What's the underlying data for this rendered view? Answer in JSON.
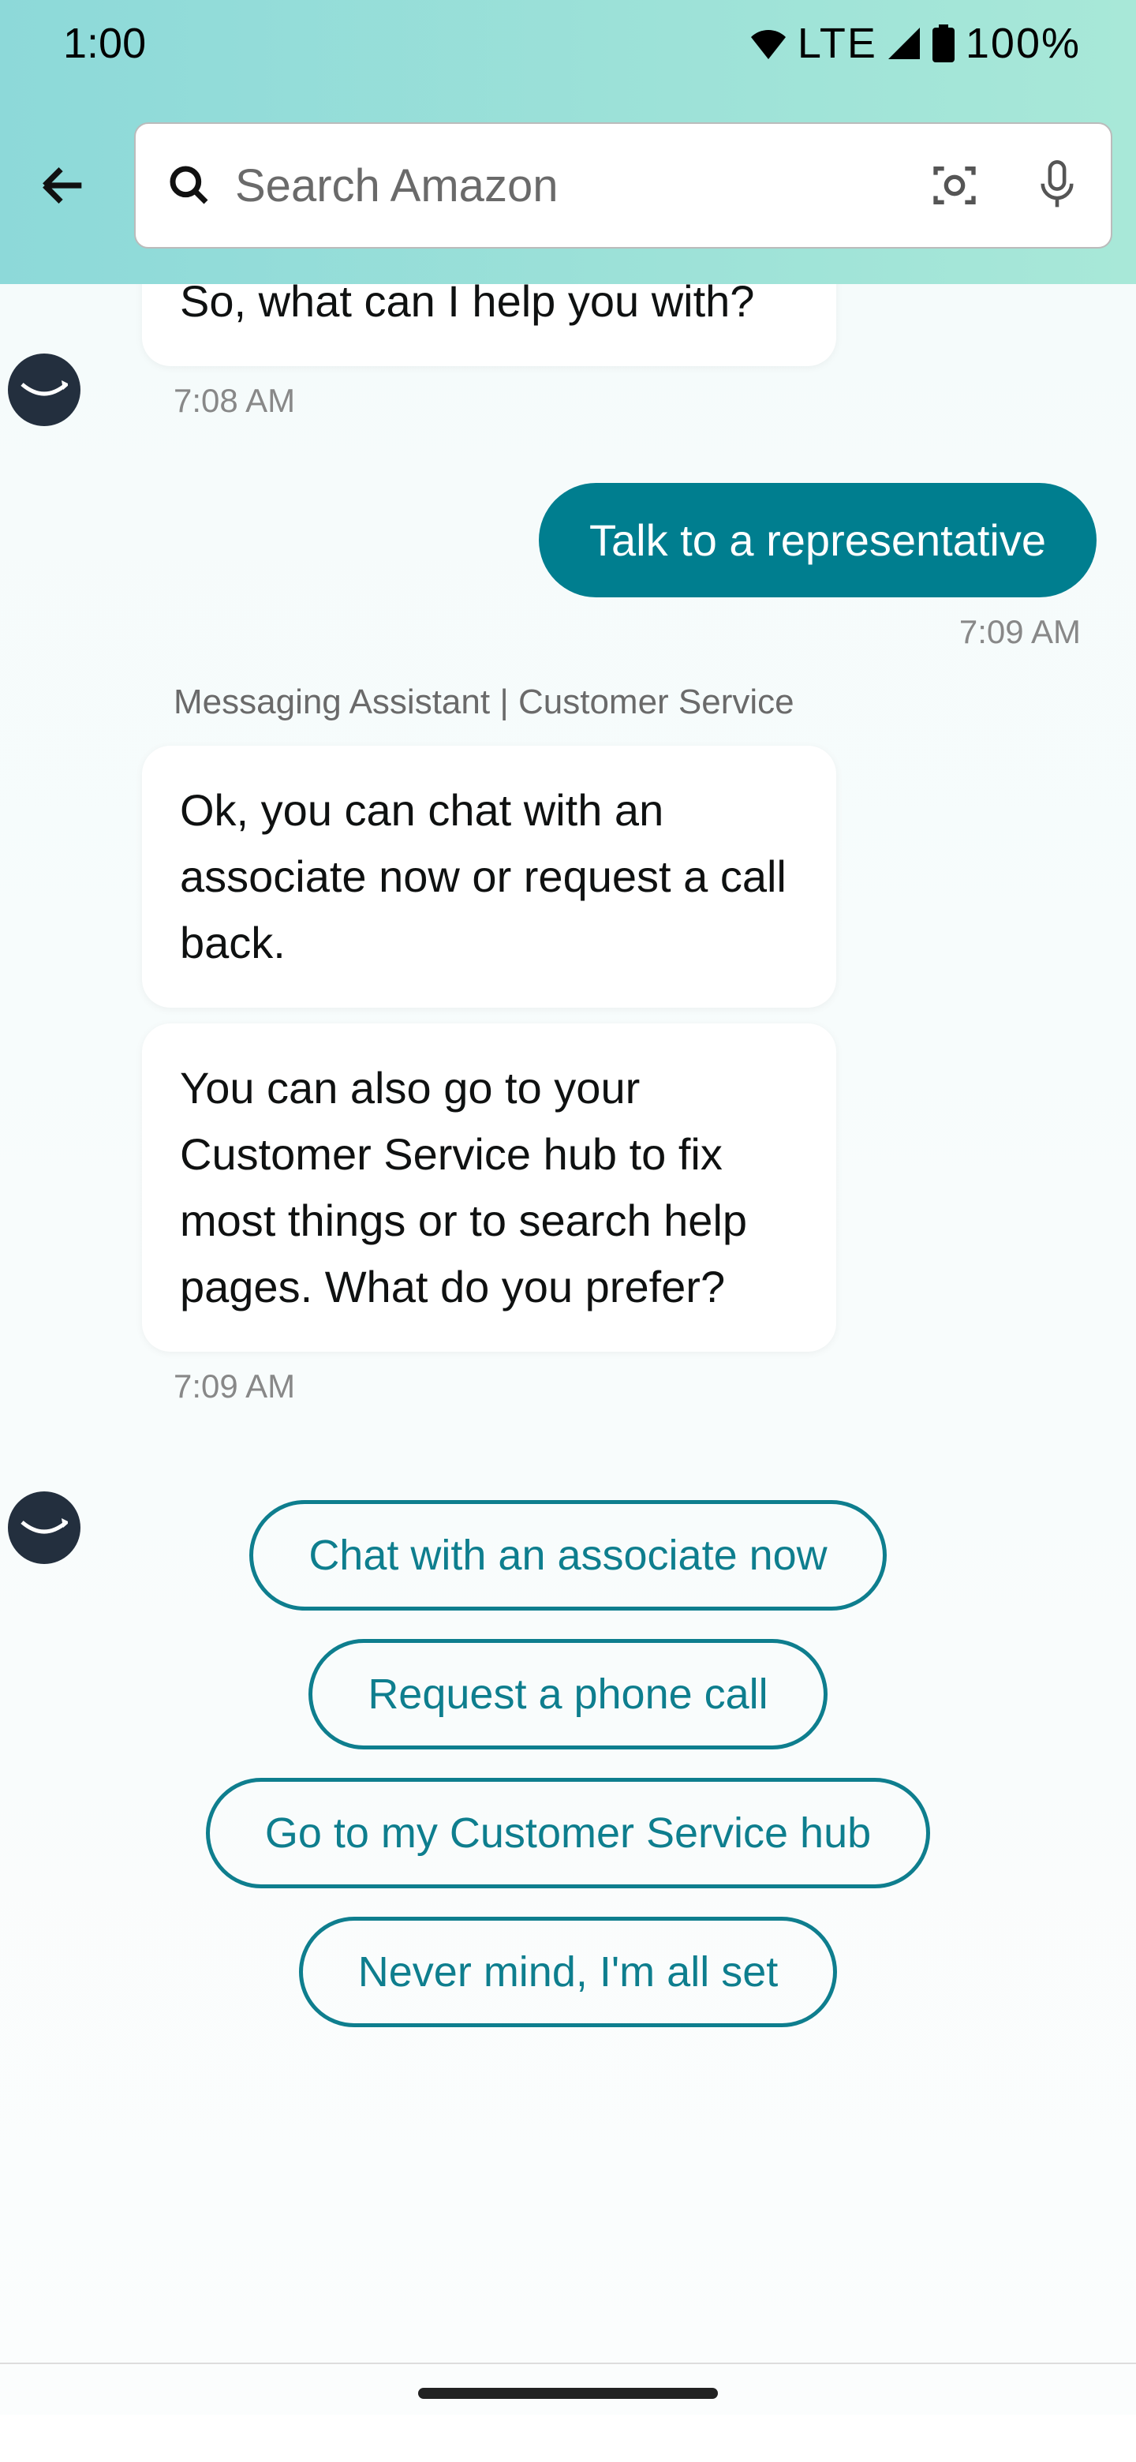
{
  "status": {
    "time": "1:00",
    "net": "LTE",
    "battery": "100%"
  },
  "header": {
    "search_placeholder": "Search Amazon"
  },
  "chat": {
    "bot_msg_0": "So, what can I help you with?",
    "ts_0": "7:08 AM",
    "user_msg_1": "Talk to a representative",
    "ts_1": "7:09 AM",
    "sender_label": "Messaging Assistant | Customer Service",
    "bot_msg_2a": "Ok, you can chat with an associate now or request a call back.",
    "bot_msg_2b": "You can also go to your Customer Service hub to fix most things or to search help pages. What do you prefer?",
    "ts_2": "7:09 AM"
  },
  "options": {
    "opt1": "Chat with an associate now",
    "opt2": "Request a phone call",
    "opt3": "Go to my Customer Service hub",
    "opt4": "Never mind, I'm all set"
  }
}
